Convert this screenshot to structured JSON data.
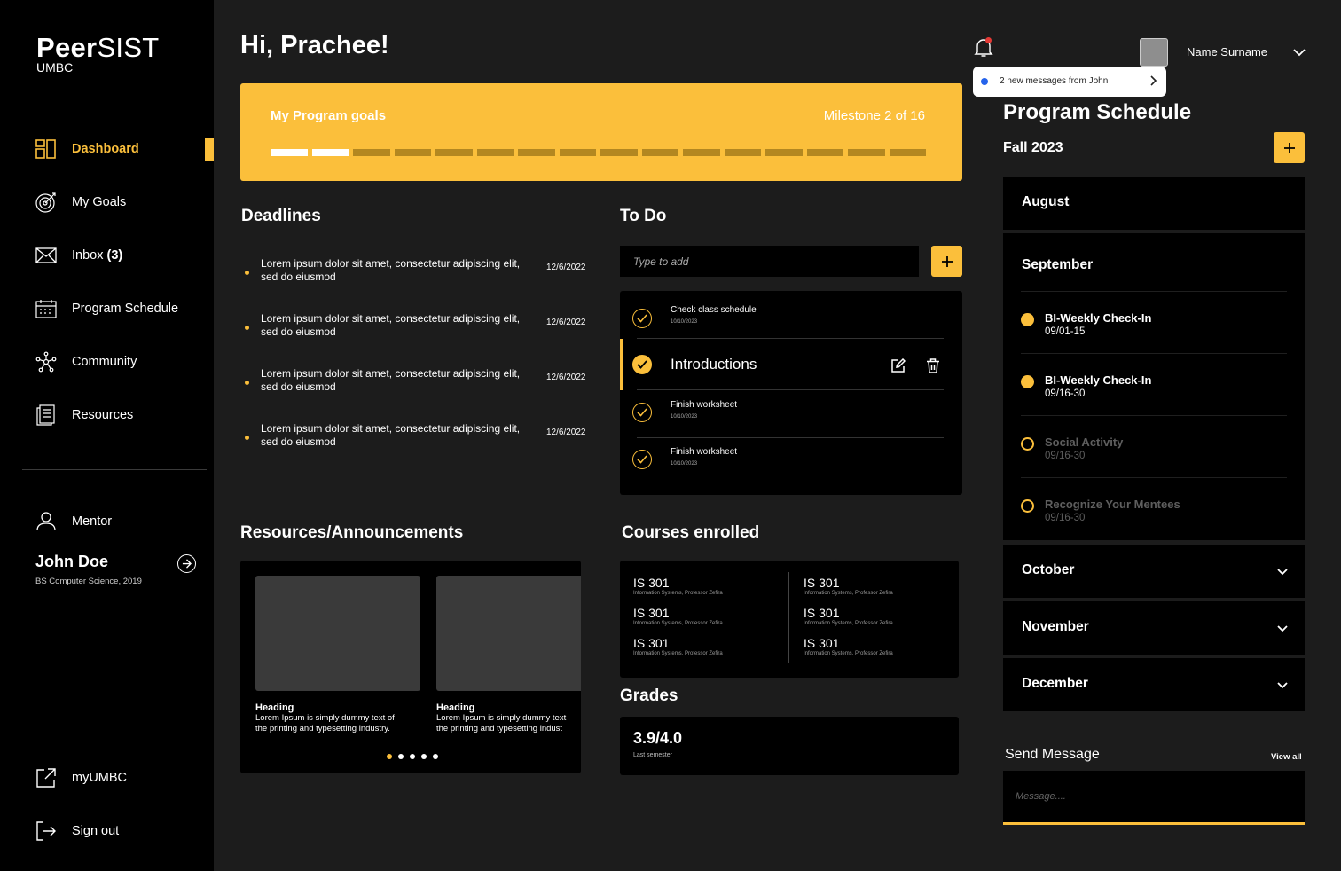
{
  "brand": {
    "name_bold": "Peer",
    "name_light": "SIST",
    "sub": "UMBC"
  },
  "sidebar": {
    "items": [
      {
        "label": "Dashboard",
        "icon": "dashboard-icon"
      },
      {
        "label": "My Goals",
        "icon": "target-icon"
      },
      {
        "label": "Inbox",
        "count": "(3)",
        "icon": "mail-icon"
      },
      {
        "label": "Program Schedule",
        "icon": "calendar-icon"
      },
      {
        "label": "Community",
        "icon": "network-icon"
      },
      {
        "label": "Resources",
        "icon": "document-icon"
      }
    ],
    "mentor": {
      "label": "Mentor",
      "name": "John Doe",
      "sub": "BS Computer Science, 2019"
    },
    "bottom": [
      {
        "label": "myUMBC",
        "icon": "external-link-icon"
      },
      {
        "label": "Sign out",
        "icon": "sign-out-icon"
      }
    ]
  },
  "header": {
    "greeting": "Hi, Prachee!",
    "user_name": "Name Surname",
    "notification": "2 new messages from John"
  },
  "goals": {
    "title": "My Program goals",
    "milestone": "Milestone 2 of 16",
    "completed": 2,
    "total": 16
  },
  "deadlines": {
    "title": "Deadlines",
    "items": [
      {
        "text": "Lorem ipsum dolor sit amet, consectetur adipiscing elit, sed do eiusmod",
        "date": "12/6/2022"
      },
      {
        "text": "Lorem ipsum dolor sit amet, consectetur adipiscing elit, sed do eiusmod",
        "date": "12/6/2022"
      },
      {
        "text": "Lorem ipsum dolor sit amet, consectetur adipiscing elit, sed do eiusmod",
        "date": "12/6/2022"
      },
      {
        "text": "Lorem ipsum dolor sit amet, consectetur adipiscing elit, sed do eiusmod",
        "date": "12/6/2022"
      }
    ]
  },
  "todo": {
    "title": "To Do",
    "placeholder": "Type to add",
    "items": [
      {
        "title": "Check  class schedule",
        "date": "10/10/2023"
      },
      {
        "title": "Introductions",
        "date": ""
      },
      {
        "title": "Finish worksheet",
        "date": "10/10/2023"
      },
      {
        "title": "Finish worksheet",
        "date": "10/10/2023"
      }
    ]
  },
  "resources": {
    "title": "Resources/Announcements",
    "cards": [
      {
        "heading": "Heading",
        "l1": "Lorem Ipsum is simply dummy text of",
        "l2": "the printing and typesetting industry."
      },
      {
        "heading": "Heading",
        "l1": "Lorem Ipsum is simply dummy text",
        "l2": "the printing and typesetting indust"
      }
    ]
  },
  "courses": {
    "title": "Courses enrolled",
    "items": [
      {
        "code": "IS 301",
        "desc": "Information Systems, Professor Zefira"
      },
      {
        "code": "IS 301",
        "desc": "Information Systems, Professor Zefira"
      },
      {
        "code": "IS 301",
        "desc": "Information Systems, Professor Zefira"
      },
      {
        "code": "IS 301",
        "desc": "Information Systems, Professor Zefira"
      },
      {
        "code": "IS 301",
        "desc": "Information Systems, Professor Zefira"
      },
      {
        "code": "IS 301",
        "desc": "Information Systems, Professor Zefira"
      }
    ]
  },
  "grades": {
    "title": "Grades",
    "value": "3.9/4.0",
    "sub": "Last semester"
  },
  "schedule": {
    "title": "Program Schedule",
    "term": "Fall 2023",
    "months": [
      "August",
      "September",
      "October",
      "November",
      "December"
    ],
    "events": [
      {
        "name": "BI-Weekly Check-In",
        "date": "09/01-15"
      },
      {
        "name": "BI-Weekly Check-In",
        "date": "09/16-30"
      },
      {
        "name": "Social Activity",
        "date": "09/16-30"
      },
      {
        "name": "Recognize Your Mentees",
        "date": "09/16-30"
      }
    ]
  },
  "message": {
    "label": "Send Message",
    "view_all": "View all",
    "placeholder": "Message...."
  },
  "colors": {
    "accent": "#fbbf3b",
    "sidebar": "#000000",
    "background": "#1c1c1c"
  }
}
